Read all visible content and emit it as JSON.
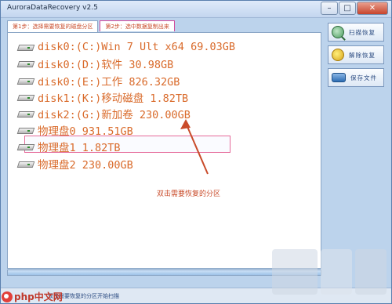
{
  "window": {
    "title": "AuroraDataRecovery v2.5",
    "minimize_glyph": "–",
    "maximize_glyph": "□",
    "close_glyph": "✕"
  },
  "tabs": [
    {
      "label": "第1步：选择需要恢复的磁盘分区"
    },
    {
      "label": "第2步：选中数据复制出来"
    }
  ],
  "partitions": [
    {
      "label": "disk0:(C:)Win 7 Ult x64 69.03GB",
      "icon": "drive-icon"
    },
    {
      "label": "disk0:(D:)软件 30.98GB",
      "icon": "drive-icon"
    },
    {
      "label": "disk0:(E:)工作 826.32GB",
      "icon": "drive-icon"
    },
    {
      "label": "disk1:(K:)移动磁盘 1.82TB",
      "icon": "drive-icon"
    },
    {
      "label": "disk2:(G:)新加卷 230.00GB",
      "icon": "drive-icon",
      "selected": true
    },
    {
      "label": "物理盘0 931.51GB",
      "icon": "drive-icon"
    },
    {
      "label": "物理盘1 1.82TB",
      "icon": "drive-icon"
    },
    {
      "label": "物理盘2 230.00GB",
      "icon": "drive-icon"
    }
  ],
  "annotation": {
    "text": "双击需要恢复的分区",
    "color": "#c94b2a"
  },
  "actions": [
    {
      "label": "扫描恢复",
      "icon": "scan-icon"
    },
    {
      "label": "解除恢复",
      "icon": "restore-icon"
    },
    {
      "label": "保存文件",
      "icon": "save-icon"
    }
  ],
  "status": {
    "text": "双击需要恢复的分区开始扫描"
  },
  "watermark": {
    "site": "php中文网"
  },
  "colors": {
    "accent": "#d96a2a",
    "selection_border": "#e56a9a",
    "window_bg": "#bcd3ec"
  }
}
